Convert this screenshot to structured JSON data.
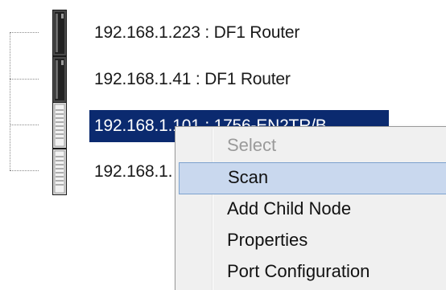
{
  "tree": {
    "nodes": [
      {
        "label": "192.168.1.223 : DF1 Router",
        "icon": "plc-module-dark-icon",
        "selected": false
      },
      {
        "label": "192.168.1.41 : DF1 Router",
        "icon": "plc-module-dark-icon",
        "selected": false
      },
      {
        "label": "192.168.1.101 : 1756-EN2TR/B",
        "icon": "plc-module-light-icon",
        "selected": true
      },
      {
        "label": "192.168.1.",
        "icon": "plc-module-light-icon",
        "selected": false
      }
    ]
  },
  "context_menu": {
    "items": [
      {
        "label": "Select",
        "state": "disabled"
      },
      {
        "label": "Scan",
        "state": "hover"
      },
      {
        "label": "Add Child Node",
        "state": "normal"
      },
      {
        "label": "Properties",
        "state": "normal"
      },
      {
        "label": "Port Configuration",
        "state": "normal"
      }
    ]
  },
  "colors": {
    "selection_bg": "#0b2a6f",
    "menu_bg": "#f0f0f0",
    "menu_hover_bg": "#c9d8ee",
    "menu_hover_border": "#7da2ce",
    "disabled_text": "#9a9a9a"
  }
}
